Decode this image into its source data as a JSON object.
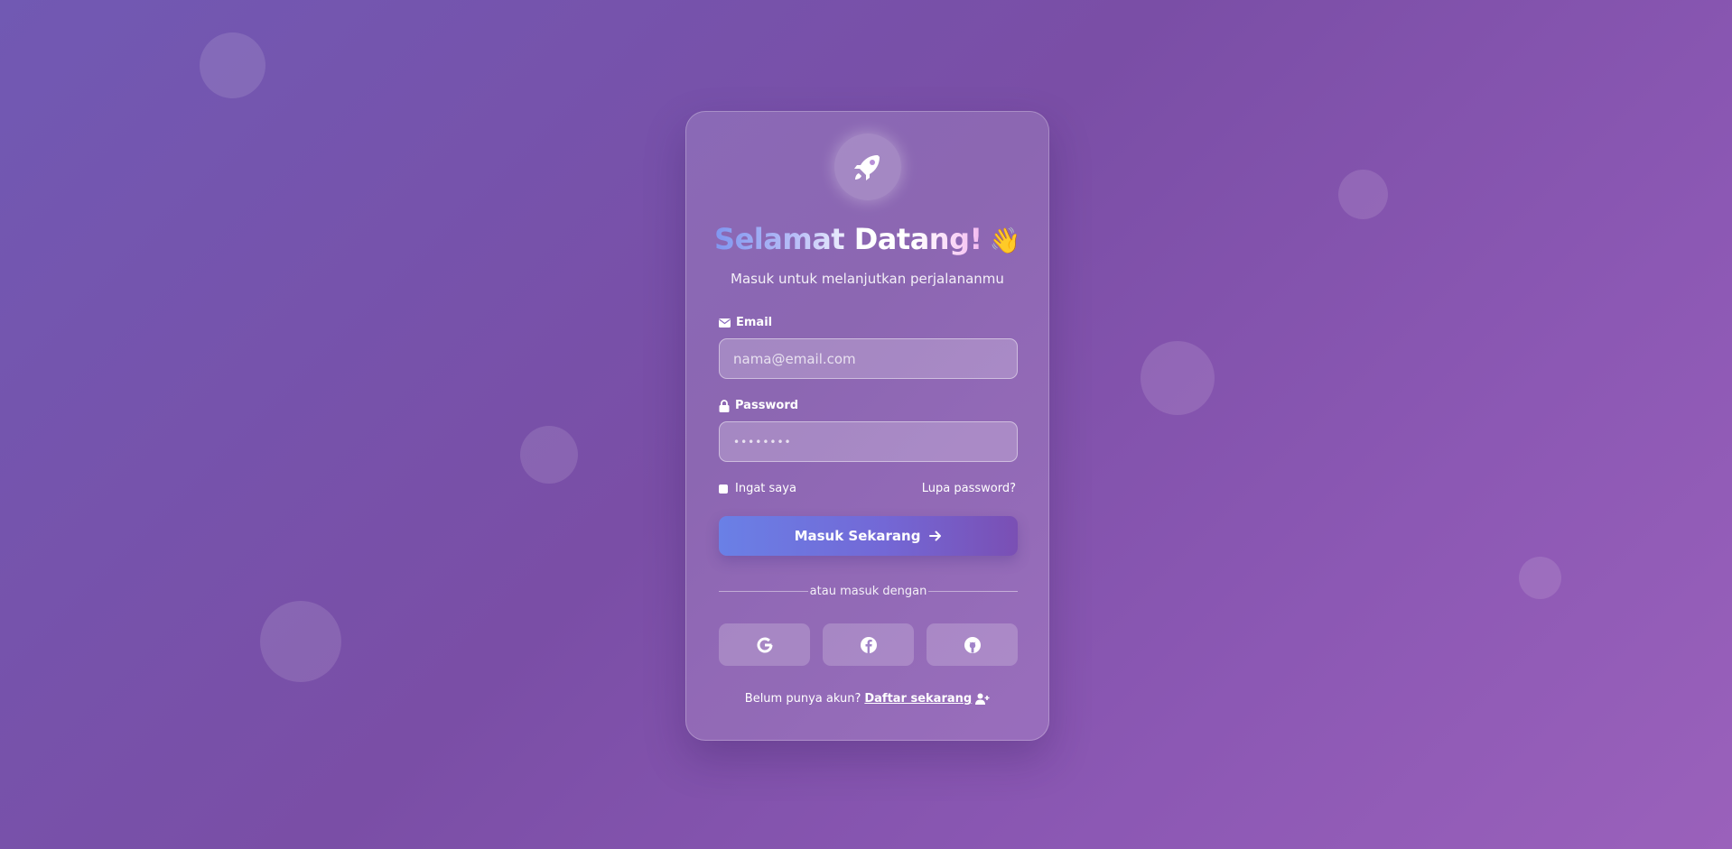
{
  "header": {
    "title_part_1": "Selamat",
    "title_part_2": "Datang!",
    "wave_emoji": "👋",
    "subtitle": "Masuk untuk melanjutkan perjalananmu"
  },
  "form": {
    "email_label": "Email",
    "email_placeholder": "nama@email.com",
    "password_label": "Password",
    "password_value": "••••••••",
    "remember_label": "Ingat saya",
    "forgot_label": "Lupa password?",
    "submit_label": "Masuk Sekarang"
  },
  "divider": {
    "text": "atau masuk dengan"
  },
  "social": [
    {
      "name": "google",
      "icon": "google-icon"
    },
    {
      "name": "facebook",
      "icon": "facebook-icon"
    },
    {
      "name": "github",
      "icon": "github-icon"
    }
  ],
  "footer": {
    "prompt": "Belum punya akun?",
    "signup_label": "Daftar sekarang"
  },
  "colors": {
    "background_start": "#7159b3",
    "background_end": "#9a61bb",
    "button_start": "#6a80e6",
    "button_end": "#7a4fb4"
  }
}
